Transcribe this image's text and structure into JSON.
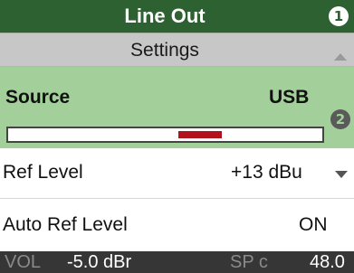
{
  "header": {
    "title": "Line Out",
    "badge": "1"
  },
  "subheader": {
    "title": "Settings",
    "scroll_indicator": "scroll-up-arrow"
  },
  "source": {
    "label": "Source",
    "value": "USB",
    "badge": "2",
    "meter_marker_fraction": 0.61
  },
  "ref_level": {
    "label": "Ref Level",
    "value": "+13 dBu"
  },
  "auto_ref_level": {
    "label": "Auto Ref Level",
    "value": "ON"
  },
  "status": {
    "vol_label": "VOL",
    "vol_value": "-5.0 dBr",
    "sp_label": "SP c",
    "sp_value": "48.0"
  },
  "colors": {
    "header_bg": "#2d6131",
    "settings_bg": "#c7c7c7",
    "source_bg": "#a3cf9b",
    "meter_marker": "#b2121b",
    "status_bg": "#363636"
  }
}
